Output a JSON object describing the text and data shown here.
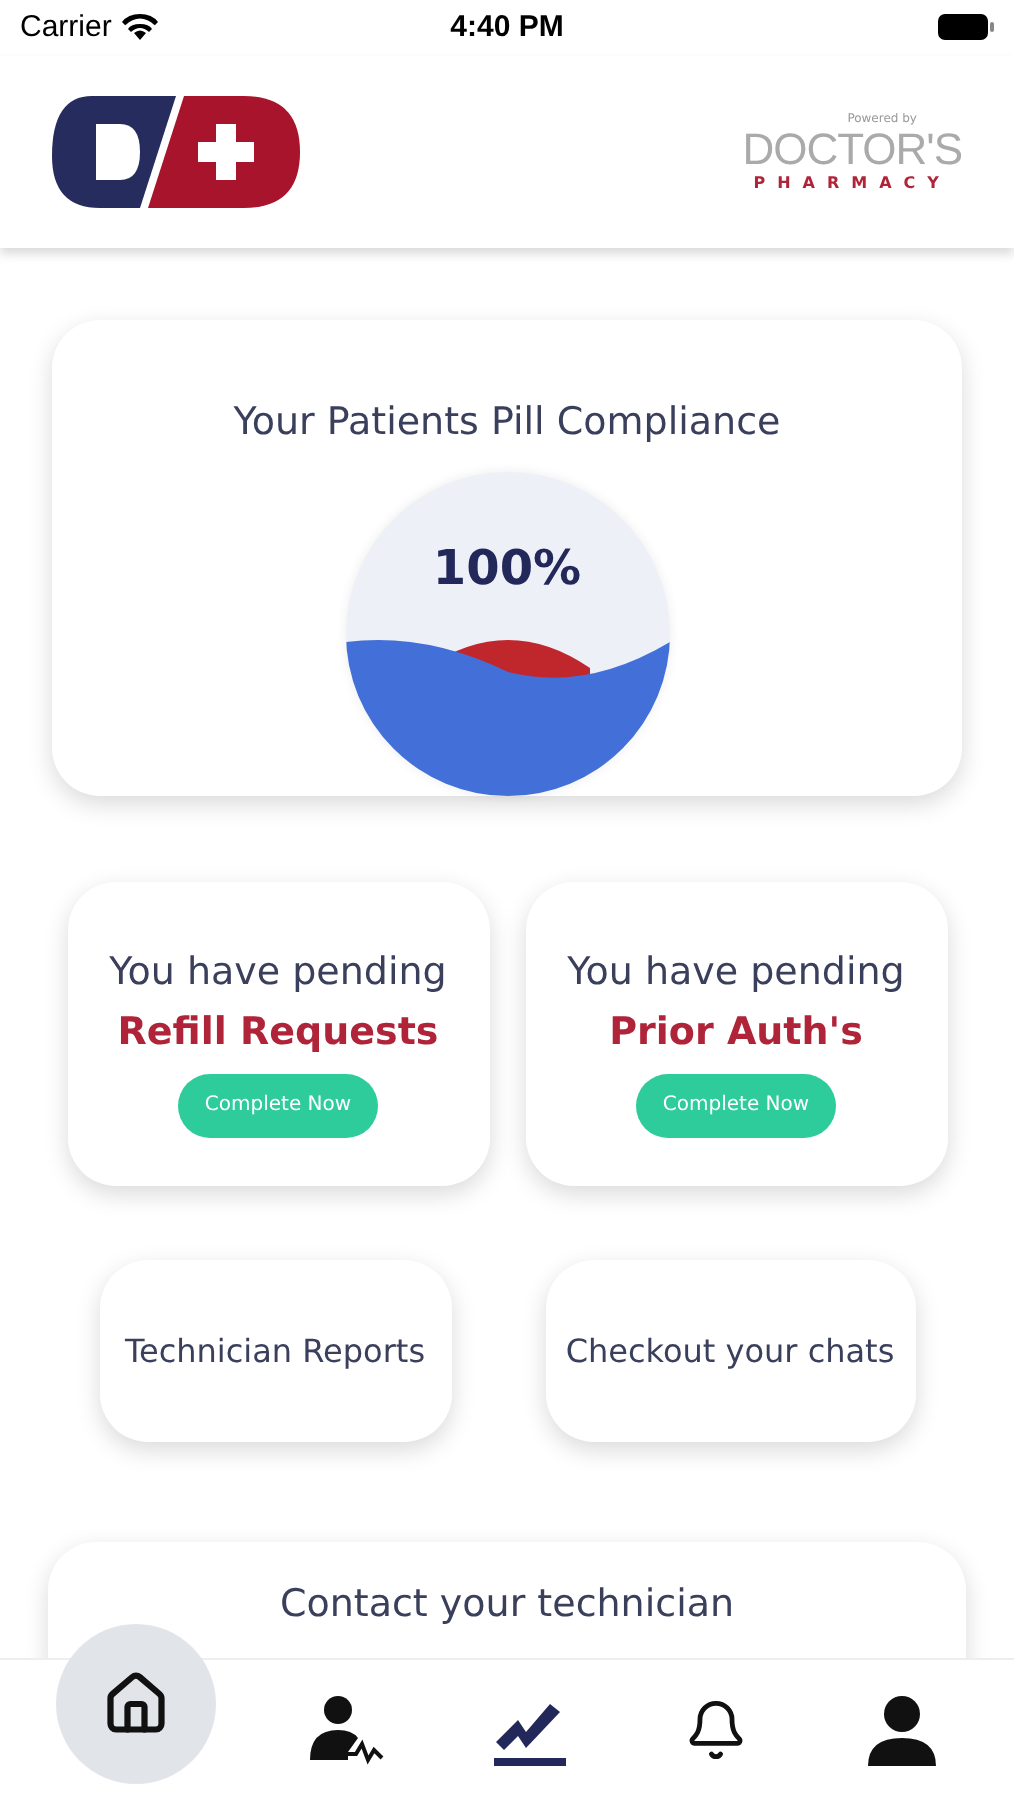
{
  "status_bar": {
    "carrier": "Carrier",
    "time": "4:40 PM"
  },
  "header": {
    "powered_by": "Powered by",
    "brand": "DOCTOR'S",
    "brand_sub": "PHARMACY"
  },
  "compliance": {
    "title": "Your Patients Pill Compliance",
    "value": "100%"
  },
  "pending": [
    {
      "line": "You have pending",
      "title": "Refill Requests",
      "button": "Complete Now"
    },
    {
      "line": "You have pending",
      "title": "Prior Auth's",
      "button": "Complete Now"
    }
  ],
  "links": [
    "Technician Reports",
    "Checkout your chats"
  ],
  "contact": {
    "title": "Contact your technician"
  },
  "nav_items": [
    {
      "kind": "home",
      "selected": true
    },
    {
      "kind": "patient",
      "selected": false
    },
    {
      "kind": "chart",
      "selected": false
    },
    {
      "kind": "bell",
      "selected": false
    },
    {
      "kind": "user",
      "selected": false
    }
  ]
}
